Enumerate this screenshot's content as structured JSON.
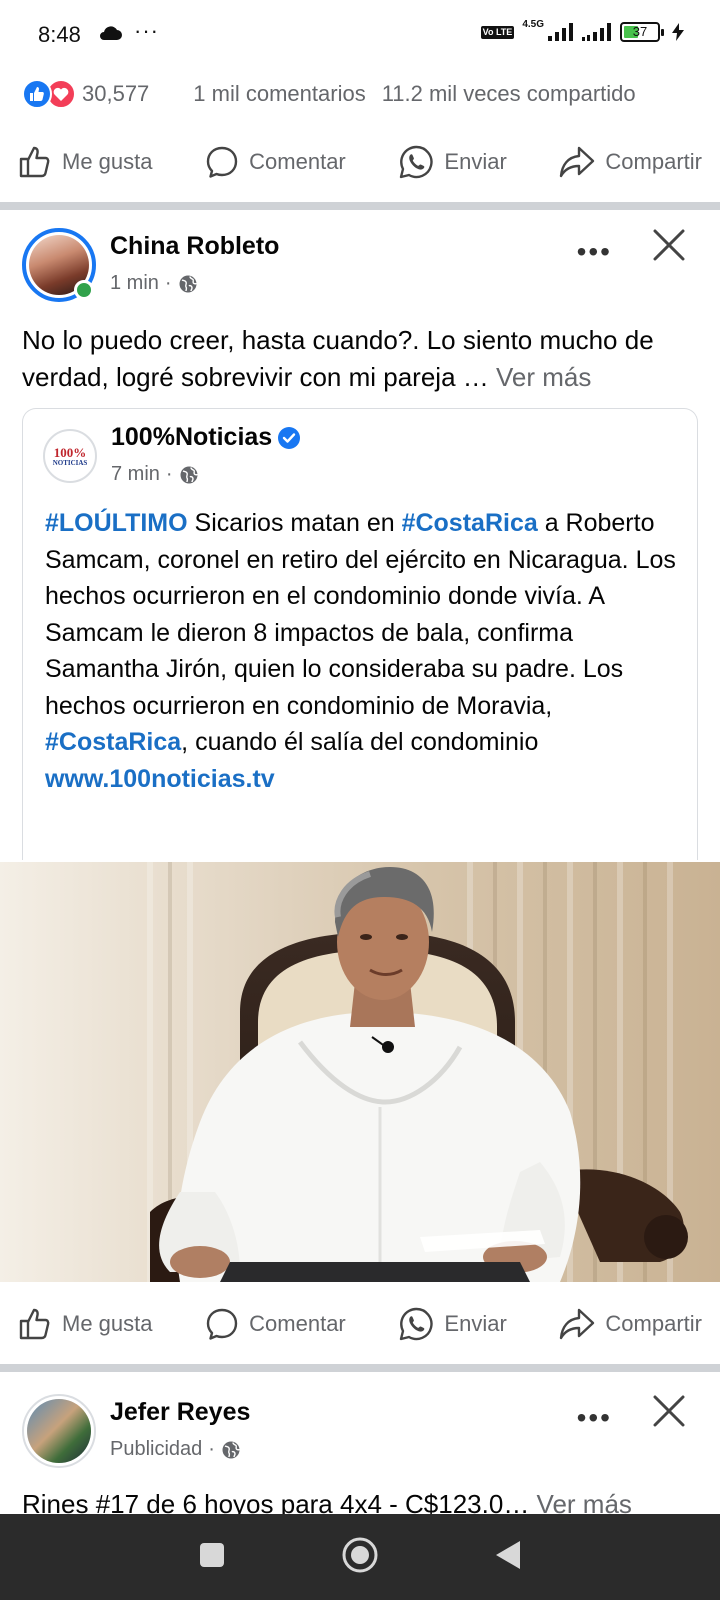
{
  "status_bar": {
    "time": "8:48",
    "net_type": "4.5G",
    "volte": "Vo LTE",
    "battery": "37"
  },
  "reactions": {
    "count": "30,577",
    "comments": "1 mil comentarios",
    "shares": "11.2 mil veces compartido"
  },
  "actions": {
    "like": "Me gusta",
    "comment": "Comentar",
    "send": "Enviar",
    "share": "Compartir"
  },
  "post": {
    "author": "China Robleto",
    "time": "1 min",
    "dot": "·",
    "text": "No lo puedo creer, hasta cuando?. Lo siento mucho de verdad, logré sobrevivir con mi pareja … ",
    "see_more": "Ver más",
    "shared": {
      "page_name": "100%Noticias",
      "logo_top": "100%",
      "logo_bottom": "NOTICIAS",
      "time": "7 min",
      "hashtag1": "#LOÚLTIMO",
      "seg1": " Sicarios matan en ",
      "hashtag2": "#CostaRica",
      "seg2": " a Roberto Samcam, coronel en retiro del ejército en Nicaragua. Los hechos ocurrieron en el condominio donde vivía.  A Samcam le dieron 8 impactos de bala, confirma Samantha Jirón, quien lo consideraba su padre.  Los hechos ocurrieron en condominio de Moravia, ",
      "hashtag3": "#CostaRica",
      "seg3": ", cuando él salía del condominio",
      "link": "www.100noticias.tv"
    }
  },
  "next_post": {
    "author": "Jefer Reyes",
    "label": "Publicidad",
    "text": "Rines #17 de 6 hoyos para  4x4 - C$123.0… ",
    "see_more": "Ver más"
  },
  "colors": {
    "brand_blue": "#1877f2",
    "love_red": "#f33e58",
    "hashtag": "#1a6fc5",
    "secondary_text": "#65676b"
  }
}
